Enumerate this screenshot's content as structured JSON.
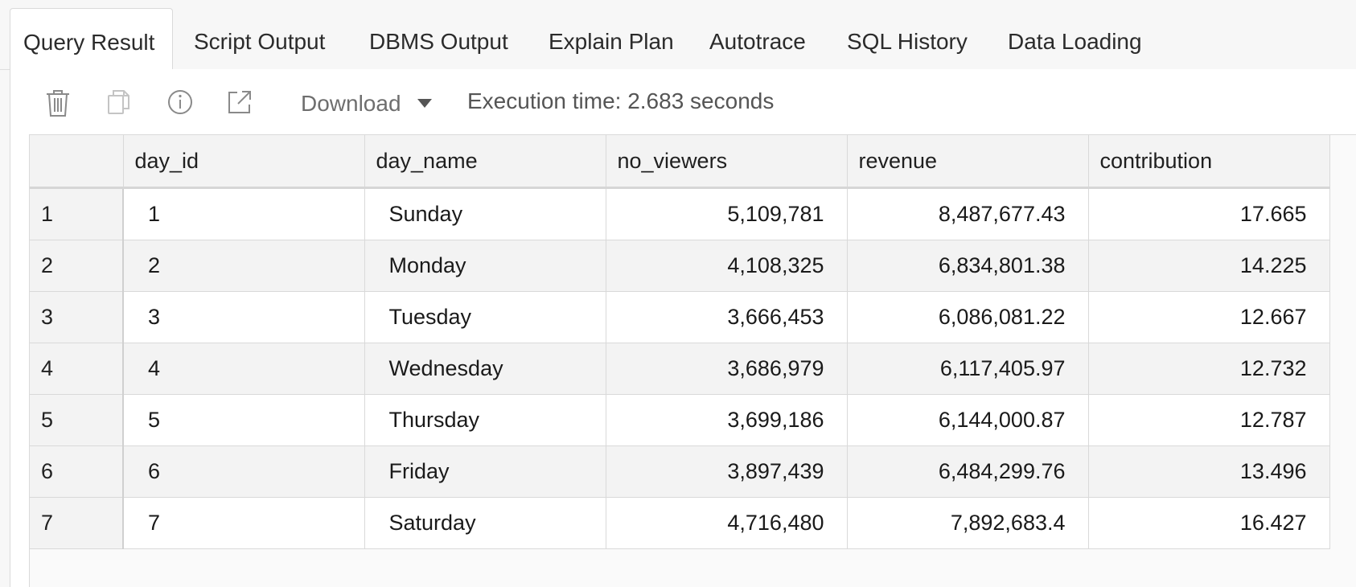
{
  "tabs": [
    {
      "label": "Query Result",
      "active": true
    },
    {
      "label": "Script Output",
      "active": false
    },
    {
      "label": "DBMS Output",
      "active": false
    },
    {
      "label": "Explain Plan",
      "active": false
    },
    {
      "label": "Autotrace",
      "active": false
    },
    {
      "label": "SQL History",
      "active": false
    },
    {
      "label": "Data Loading",
      "active": false
    }
  ],
  "toolbar": {
    "icons": [
      "trash-icon",
      "copy-icon",
      "info-icon",
      "open-external-icon"
    ],
    "download_label": "Download",
    "execution_time": "Execution time: 2.683 seconds"
  },
  "grid": {
    "columns": [
      "day_id",
      "day_name",
      "no_viewers",
      "revenue",
      "contribution"
    ],
    "rows": [
      {
        "row": "1",
        "day_id": "1",
        "day_name": "Sunday",
        "no_viewers": "5,109,781",
        "revenue": "8,487,677.43",
        "contribution": "17.665"
      },
      {
        "row": "2",
        "day_id": "2",
        "day_name": "Monday",
        "no_viewers": "4,108,325",
        "revenue": "6,834,801.38",
        "contribution": "14.225"
      },
      {
        "row": "3",
        "day_id": "3",
        "day_name": "Tuesday",
        "no_viewers": "3,666,453",
        "revenue": "6,086,081.22",
        "contribution": "12.667"
      },
      {
        "row": "4",
        "day_id": "4",
        "day_name": "Wednesday",
        "no_viewers": "3,686,979",
        "revenue": "6,117,405.97",
        "contribution": "12.732"
      },
      {
        "row": "5",
        "day_id": "5",
        "day_name": "Thursday",
        "no_viewers": "3,699,186",
        "revenue": "6,144,000.87",
        "contribution": "12.787"
      },
      {
        "row": "6",
        "day_id": "6",
        "day_name": "Friday",
        "no_viewers": "3,897,439",
        "revenue": "6,484,299.76",
        "contribution": "13.496"
      },
      {
        "row": "7",
        "day_id": "7",
        "day_name": "Saturday",
        "no_viewers": "4,716,480",
        "revenue": "7,892,683.4",
        "contribution": "16.427"
      }
    ]
  },
  "colors": {
    "tab_text": "#2b2b2b",
    "icon_gray": "#8a8a8a",
    "icon_disabled": "#c4c4c4",
    "header_bg": "#f3f3f3",
    "row_alt_bg": "#f3f3f3"
  }
}
